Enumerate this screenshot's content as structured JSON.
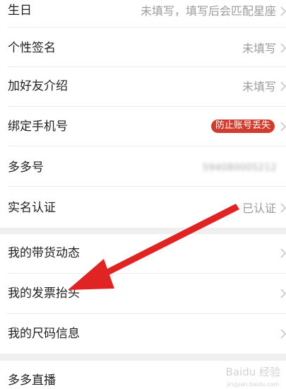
{
  "settings": {
    "birthday": {
      "label": "生日",
      "value": "未填写，填写后会匹配星座"
    },
    "signature": {
      "label": "个性签名",
      "value": "未填写"
    },
    "friend_intro": {
      "label": "加好友介绍",
      "value": "未填写"
    },
    "phone": {
      "label": "绑定手机号",
      "badge": "防止账号丢失"
    },
    "duoduo_id": {
      "label": "多多号",
      "value": "594080005212"
    },
    "real_name": {
      "label": "实名认证",
      "value": "已认证"
    },
    "live_trends": {
      "label": "我的带货动态"
    },
    "invoice": {
      "label": "我的发票抬头"
    },
    "size_info": {
      "label": "我的尺码信息"
    },
    "live": {
      "label": "多多直播"
    }
  },
  "colors": {
    "annotation_arrow": "#e02424",
    "badge_bg": "#d03c2e",
    "section_gap": "#efefef",
    "muted_text": "#9b9b9b"
  },
  "annotation": {
    "type": "arrow",
    "points_to": "我的发票抬头"
  },
  "watermark": {
    "text": "Baidu 经验",
    "sub": "jingyan.baidu.com"
  }
}
